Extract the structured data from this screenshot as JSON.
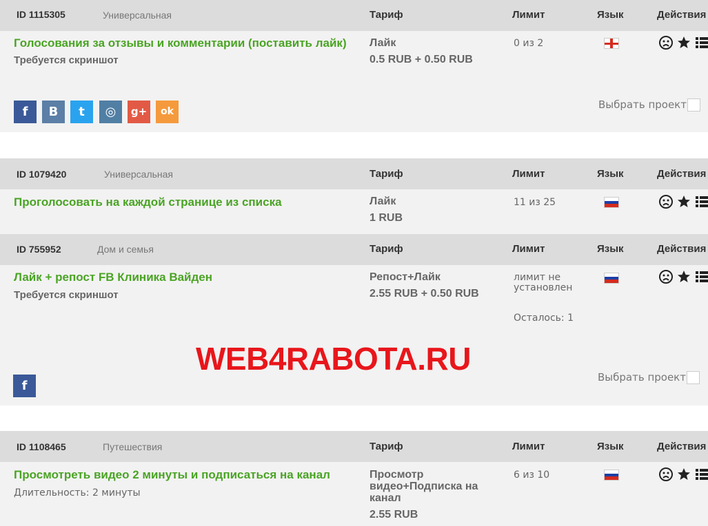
{
  "columns": {
    "tariff": "Тариф",
    "limit": "Лимит",
    "lang": "Язык",
    "actions": "Действия"
  },
  "tasks": [
    {
      "id": "ID 1115305",
      "category": "Универсальная",
      "title": "Голосования за отзывы и комментарии (поставить лайк)",
      "subtitle": "Требуется скриншот",
      "tariff_name": "Лайк",
      "tariff_price": "0.5 RUB + 0.50 RUB",
      "limit": "0 из 2",
      "language": "english-flag",
      "select_label": "Выбрать проект",
      "socials": [
        {
          "icon": "facebook-icon",
          "glyph": "f",
          "color": "#3b5998"
        },
        {
          "icon": "vkontakte-icon",
          "glyph": "В",
          "color": "#5b7fa6"
        },
        {
          "icon": "twitter-icon",
          "glyph": "t",
          "color": "#2aa3ef"
        },
        {
          "icon": "instagram-icon",
          "glyph": "◎",
          "color": "#517fa4"
        },
        {
          "icon": "google-plus-icon",
          "glyph": "g+",
          "color": "#e25a45"
        },
        {
          "icon": "odnoklassniki-icon",
          "glyph": "ok",
          "color": "#f59a3c"
        }
      ]
    },
    {
      "id": "ID 1079420",
      "category": "Универсальная",
      "title": "Проголосовать на каждой странице из списка",
      "tariff_name": "Лайк",
      "tariff_price": "1 RUB",
      "limit": "11 из 25",
      "language": "russian-flag"
    },
    {
      "id": "ID 755952",
      "category": "Дом и семья",
      "title": "Лайк + репост FB Клиника Вайден",
      "subtitle": "Требуется скриншот",
      "tariff_name": "Репост+Лайк",
      "tariff_price": "2.55 RUB + 0.50 RUB",
      "limit_line1": "лимит не",
      "limit_line2": "установлен",
      "remaining": "Осталось: 1",
      "language": "russian-flag",
      "select_label": "Выбрать проект",
      "socials": [
        {
          "icon": "facebook-icon",
          "glyph": "f",
          "color": "#3b5998"
        }
      ]
    },
    {
      "id": "ID 1108465",
      "category": "Путешествия",
      "title": "Просмотреть видео 2 минуты и подписаться на канал",
      "subtitle": "Длительность: 2 минуты",
      "tariff_line1": "Просмотр",
      "tariff_line2": "видео+Подписка на",
      "tariff_line3": "канал",
      "tariff_price": "2.55 RUB",
      "limit": "6 из 10",
      "language": "russian-flag"
    }
  ],
  "watermark": "WEB4RABOTA.RU",
  "colors": {
    "title_green": "#4aa424",
    "watermark_red": "#e8161b",
    "header_bg": "#dcdcdc",
    "row_bg": "#f2f2f2"
  }
}
